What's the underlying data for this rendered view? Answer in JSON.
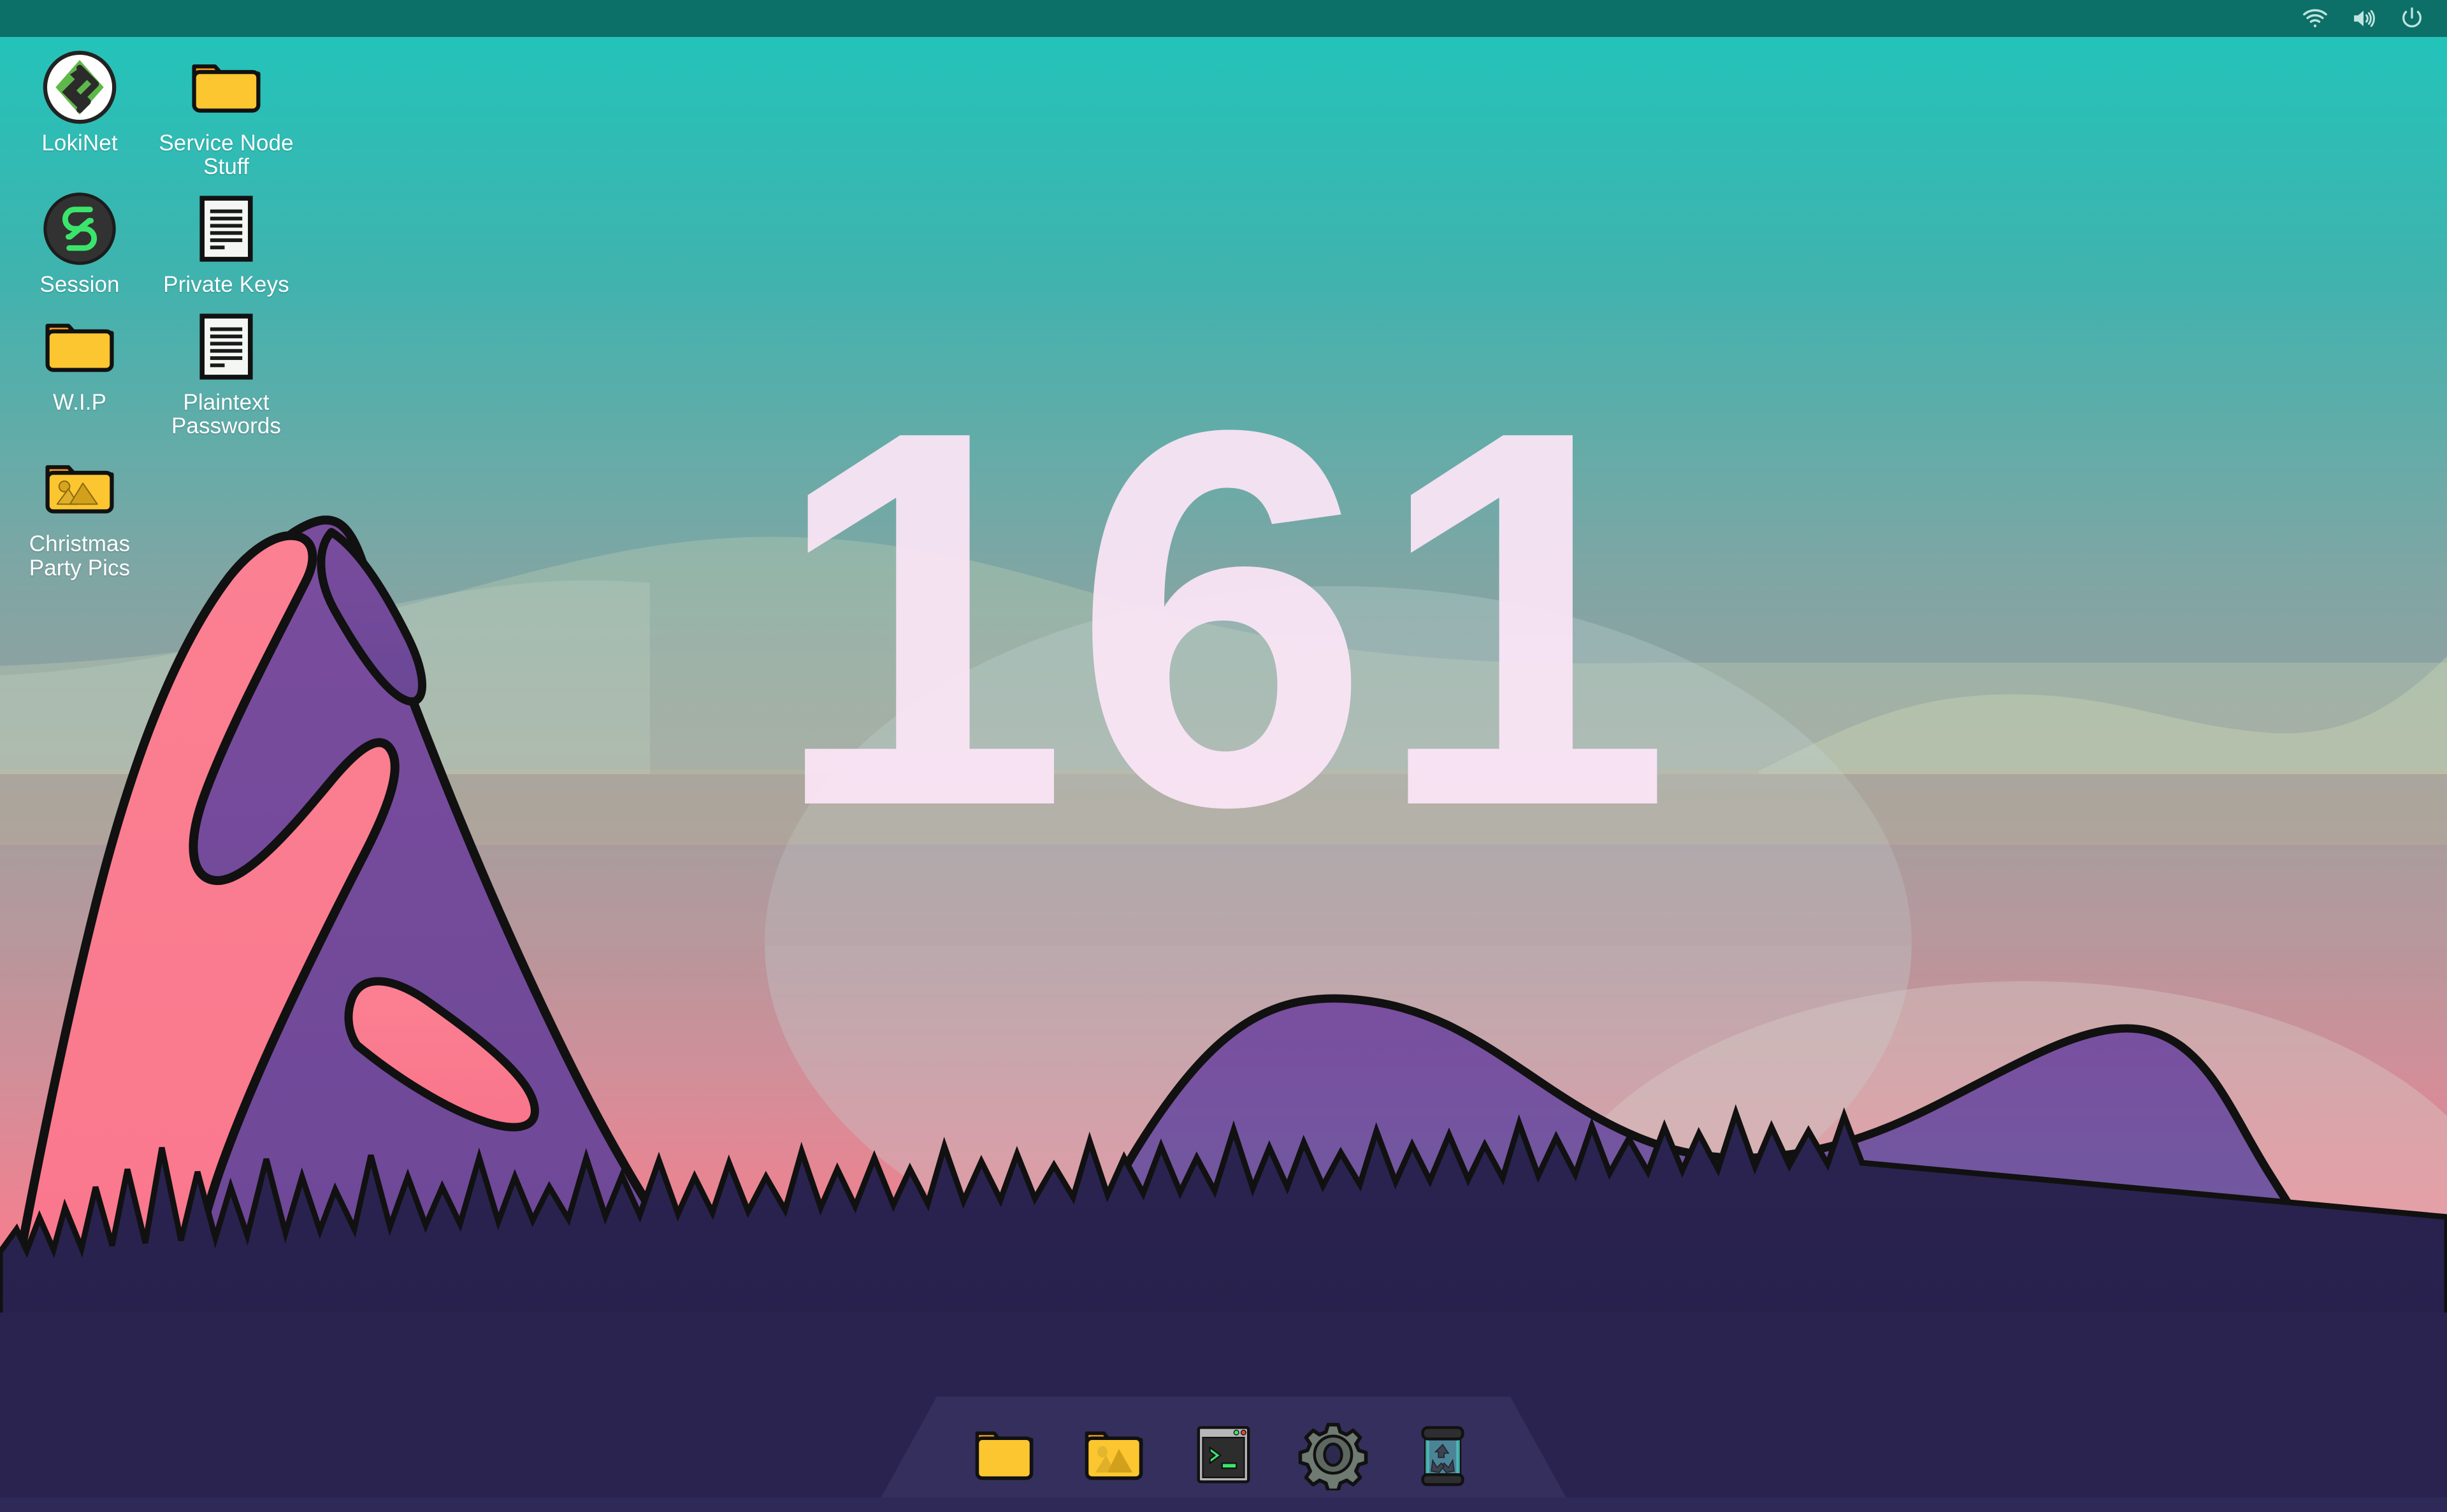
{
  "wallpaper": {
    "watermark_text": "161",
    "watermark_color": "#FCE6F7",
    "sky_top_color": "#1FC6BC",
    "sky_mid_color": "#93A6A8",
    "sky_low_color": "#F08C9C",
    "mountain_pink": "#FA7C8C",
    "mountain_purple": "#7A4C9E",
    "forest_color": "#2A2350",
    "outline_color": "#111111"
  },
  "topbar": {
    "tray": [
      {
        "name": "wifi-icon",
        "label": "Wi-Fi"
      },
      {
        "name": "volume-icon",
        "label": "Volume"
      },
      {
        "name": "power-icon",
        "label": "Power"
      }
    ],
    "tray_color": "#BFE3DE",
    "background_color": "#0C7068"
  },
  "desktop_icons": [
    {
      "label": "LokiNet",
      "icon": "lokinet-app-icon",
      "type": "application"
    },
    {
      "label": "Service Node Stuff",
      "icon": "folder-icon",
      "type": "folder"
    },
    {
      "label": "Session",
      "icon": "session-app-icon",
      "type": "application"
    },
    {
      "label": "Private Keys",
      "icon": "document-icon",
      "type": "document"
    },
    {
      "label": "W.I.P",
      "icon": "folder-icon",
      "type": "folder"
    },
    {
      "label": "Plaintext Passwords",
      "icon": "document-icon",
      "type": "document"
    },
    {
      "label": "Christmas Party Pics",
      "icon": "pictures-folder-icon",
      "type": "folder"
    }
  ],
  "dock": {
    "items": [
      {
        "label": "Files",
        "icon": "folder-icon"
      },
      {
        "label": "Pictures",
        "icon": "pictures-folder-icon"
      },
      {
        "label": "Terminal",
        "icon": "terminal-icon",
        "prompt": ">_"
      },
      {
        "label": "Settings",
        "icon": "gear-icon"
      },
      {
        "label": "Trash",
        "icon": "trash-recycle-icon"
      }
    ]
  },
  "colors": {
    "folder_body": "#FBC62F",
    "folder_tab": "#F9A119",
    "terminal_green": "#3BE56B",
    "gear_gray": "#6E7A72",
    "trash_teal": "#4C8497"
  }
}
